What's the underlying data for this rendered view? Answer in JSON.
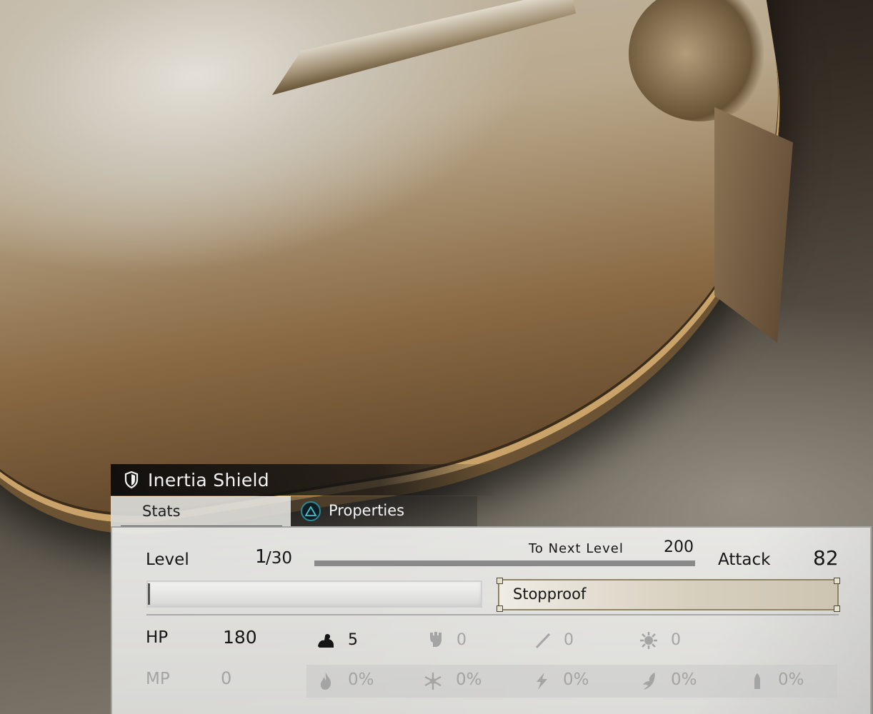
{
  "item": {
    "name": "Inertia Shield",
    "icon": "shield-icon"
  },
  "tabs": {
    "stats": "Stats",
    "properties": "Properties",
    "properties_button_icon": "triangle-button-icon"
  },
  "level": {
    "label": "Level",
    "current": "1",
    "max": "/30",
    "to_next_label": "To Next Level",
    "to_next_value": "200",
    "progress_fraction": 0.0
  },
  "attack": {
    "label": "Attack",
    "value": "82"
  },
  "properties_slots": [
    {
      "text": ""
    },
    {
      "text": "Stopproof"
    }
  ],
  "stats": {
    "hp_label": "HP",
    "hp_value": "180",
    "mp_label": "MP",
    "mp_value": "0"
  },
  "attributes": [
    {
      "icon": "strength-icon",
      "value": "5"
    },
    {
      "icon": "vitality-icon",
      "value": "0"
    },
    {
      "icon": "magic-icon",
      "value": "0"
    },
    {
      "icon": "spirit-icon",
      "value": "0"
    }
  ],
  "resistances": [
    {
      "icon": "fire-icon",
      "value": "0%"
    },
    {
      "icon": "ice-icon",
      "value": "0%"
    },
    {
      "icon": "lightning-icon",
      "value": "0%"
    },
    {
      "icon": "dark-icon",
      "value": "0%"
    },
    {
      "icon": "shot-icon",
      "value": "0%"
    }
  ],
  "colors": {
    "panel": "#ececea",
    "text": "#151515",
    "dim_text": "#a4a4a4",
    "accent_triangle": "#2a8a95"
  }
}
